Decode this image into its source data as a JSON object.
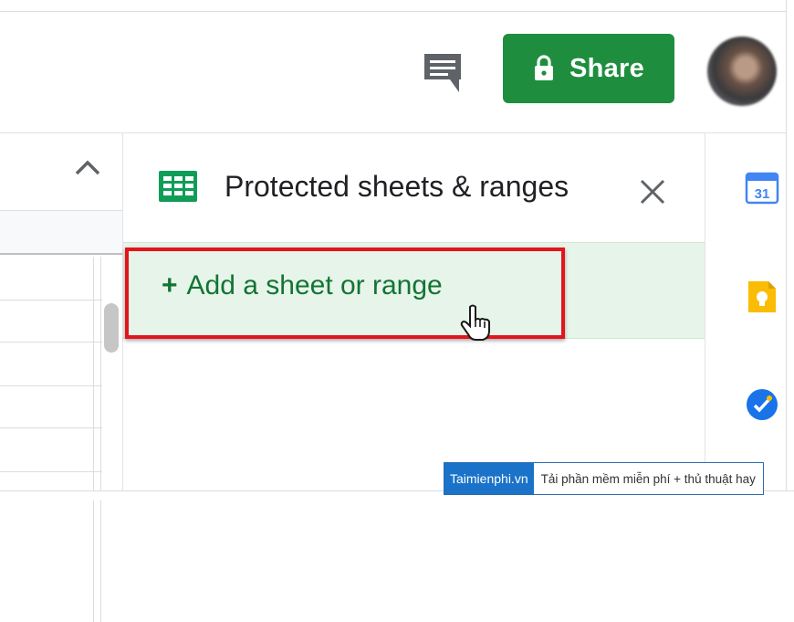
{
  "toolbar": {
    "comment_icon": "comment-icon",
    "share_label": "Share",
    "share_icon": "lock-icon",
    "share_color": "#1e8e3e",
    "avatar": "user-avatar"
  },
  "grid": {
    "collapse_icon": "chevron-up-icon"
  },
  "panel": {
    "icon": "google-sheets-icon",
    "title": "Protected sheets & ranges",
    "close_icon": "close-icon",
    "add_plus": "+",
    "add_label": "Add a sheet or range",
    "add_row_bg": "#e6f4ea",
    "highlight_color": "#e3141b"
  },
  "sidebar_rail": {
    "items": [
      {
        "icon": "google-calendar-icon",
        "label": "31"
      },
      {
        "icon": "google-keep-icon"
      },
      {
        "icon": "google-tasks-icon"
      }
    ]
  },
  "watermark": {
    "brand": "Taimienphi.vn",
    "tagline": "Tải phần mềm miễn phí + thủ thuật hay"
  }
}
